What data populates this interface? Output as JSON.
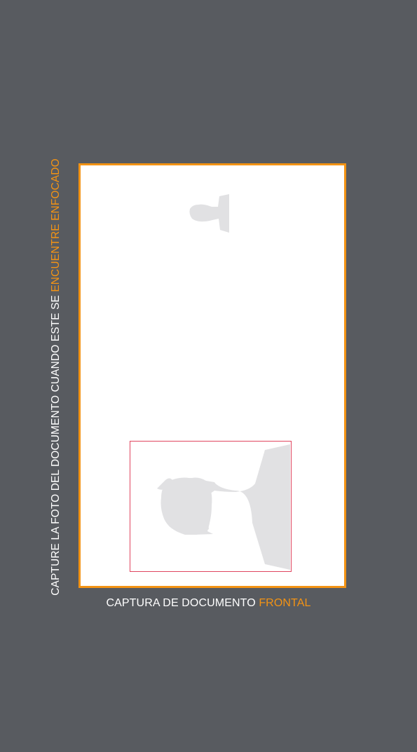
{
  "instruction": {
    "prefix": "CAPTURE LA FOTO DEL DOCUMENTO CUANDO ESTE SE ",
    "highlight": "ENCUENTRE ENFOCADO"
  },
  "caption": {
    "prefix": "CAPTURA DE DOCUMENTO ",
    "highlight": "FRONTAL"
  },
  "colors": {
    "background": "#585b60",
    "accent": "#f39314",
    "photo_border": "#e0455f",
    "silhouette": "#e1e1e3",
    "document": "#ffffff"
  },
  "icons": {
    "small_portrait": "person-silhouette-icon",
    "large_portrait": "person-silhouette-icon"
  }
}
